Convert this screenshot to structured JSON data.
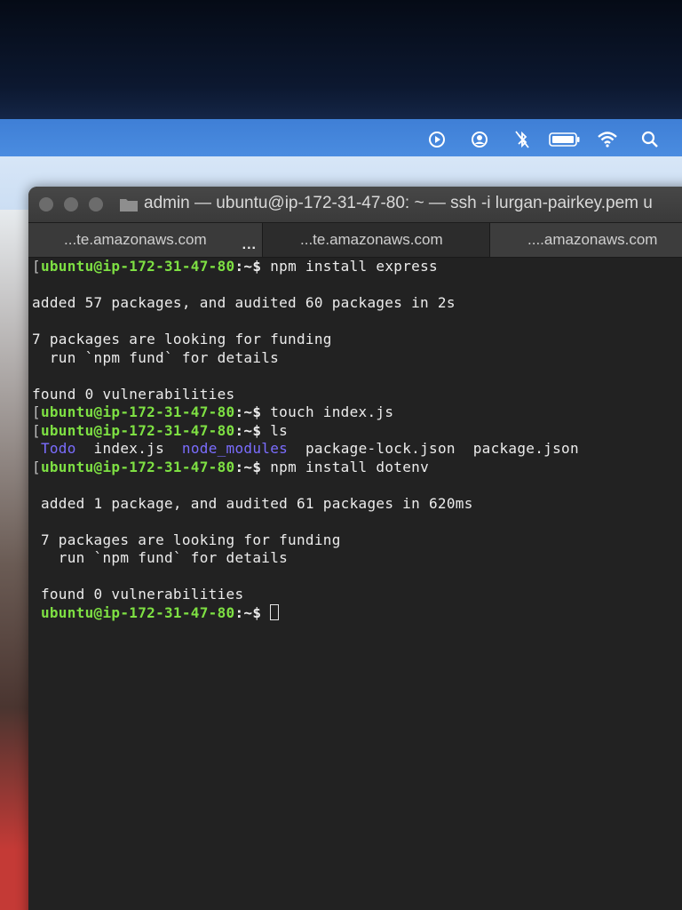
{
  "window": {
    "title": "admin — ubuntu@ip-172-31-47-80: ~ — ssh -i lurgan-pairkey.pem u"
  },
  "menubar": {
    "icons": [
      "play-circle-icon",
      "user-circle-icon",
      "bluetooth-off-icon",
      "battery-icon",
      "wifi-icon",
      "search-icon"
    ]
  },
  "tabs": [
    {
      "label": "...te.amazonaws.com",
      "more": "..."
    },
    {
      "label": "...te.amazonaws.com"
    },
    {
      "label": "....amazonaws.com"
    }
  ],
  "terminal": {
    "prompt": "ubuntu@ip-172-31-47-80",
    "prompt_suffix": ":~$",
    "bracket": "[",
    "lines": {
      "l1_cmd": " npm install express",
      "l3": "added 57 packages, and audited 60 packages in 2s",
      "l5": "7 packages are looking for funding",
      "l6": "  run `npm fund` for details",
      "l8": "found 0 vulnerabilities",
      "l9_cmd": " touch index.js",
      "l10_cmd": " ls",
      "ls_todo": "Todo",
      "ls_index": "index.js",
      "ls_node_modules": "node_modules",
      "ls_package_lock": "package-lock.json",
      "ls_package": "package.json",
      "l12_cmd": " npm install dotenv",
      "l14": "added 1 package, and audited 61 packages in 620ms",
      "l16": "7 packages are looking for funding",
      "l17": "  run `npm fund` for details",
      "l19": "found 0 vulnerabilities"
    }
  },
  "colors": {
    "prompt": "#7ee043",
    "directory": "#7b6dff",
    "menubar": "#4a8ce0",
    "terminal_bg": "#222222"
  }
}
